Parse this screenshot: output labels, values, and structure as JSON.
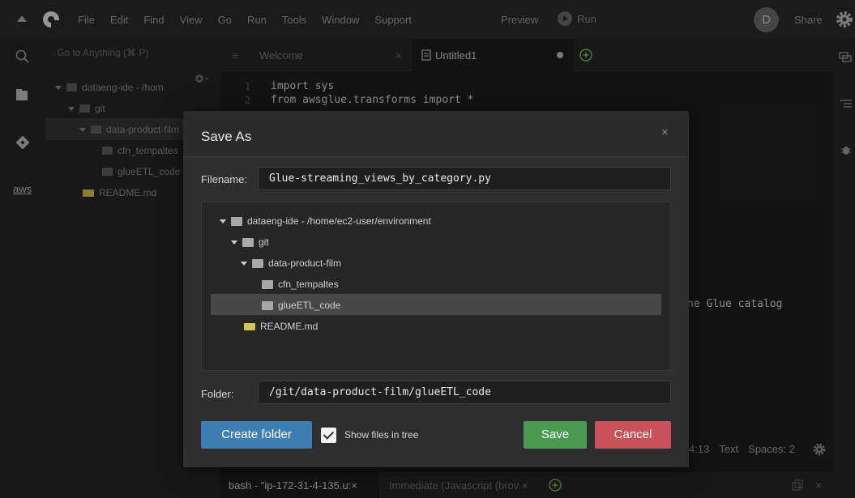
{
  "menubar": {
    "items": [
      "File",
      "Edit",
      "Find",
      "View",
      "Go",
      "Run",
      "Tools",
      "Window",
      "Support"
    ],
    "preview": "Preview",
    "run": "Run",
    "avatar_initial": "D",
    "share": "Share"
  },
  "leftbar": {
    "aws": "aws"
  },
  "sidebar": {
    "goto_placeholder": "Go to Anything (⌘ P)",
    "tree": [
      {
        "label": "dataeng-ide - /hom",
        "kind": "folder",
        "open": true
      },
      {
        "label": "git",
        "kind": "folder",
        "open": true
      },
      {
        "label": "data-product-film",
        "kind": "folder",
        "open": true
      },
      {
        "label": "cfn_tempaltes",
        "kind": "folder"
      },
      {
        "label": "glueETL_code",
        "kind": "folder"
      },
      {
        "label": "README.md",
        "kind": "md"
      }
    ]
  },
  "editor": {
    "tabs": [
      {
        "label": "Welcome",
        "close": "×"
      },
      {
        "label": "Untitled1"
      }
    ],
    "lines": [
      {
        "no": "1",
        "text": "import sys"
      },
      {
        "no": "2",
        "text": "from awsglue.transforms import *"
      }
    ],
    "partial_text": "ne Glue catalog",
    "status": {
      "position": "4:13",
      "mode": "Text",
      "spaces": "Spaces: 2"
    }
  },
  "bottom": {
    "tabs": [
      "bash - \"ip-172-31-4-135.u:",
      "Immediate (Javascript (brov"
    ],
    "close": "×"
  },
  "dialog": {
    "title": "Save As",
    "close": "×",
    "filename_label": "Filename:",
    "filename_value": "Glue-streaming_views_by_category.py",
    "tree": [
      {
        "label": "dataeng-ide",
        "suffix": " - /home/ec2-user/environment",
        "kind": "folder",
        "open": true
      },
      {
        "label": "git",
        "kind": "folder",
        "open": true
      },
      {
        "label": "data-product-film",
        "kind": "folder",
        "open": true
      },
      {
        "label": "cfn_tempaltes",
        "kind": "folder"
      },
      {
        "label": "glueETL_code",
        "kind": "folder",
        "selected": true
      },
      {
        "label": "README.md",
        "kind": "md"
      }
    ],
    "folder_label": "Folder:",
    "folder_value": "/git/data-product-film/glueETL_code",
    "create_folder": "Create folder",
    "show_files_label": "Show files in tree",
    "show_files_checked": true,
    "save": "Save",
    "cancel": "Cancel"
  },
  "colors": {
    "create_button": "#3d7fb5",
    "save_button": "#4a9a52",
    "cancel_button": "#c9525a"
  }
}
